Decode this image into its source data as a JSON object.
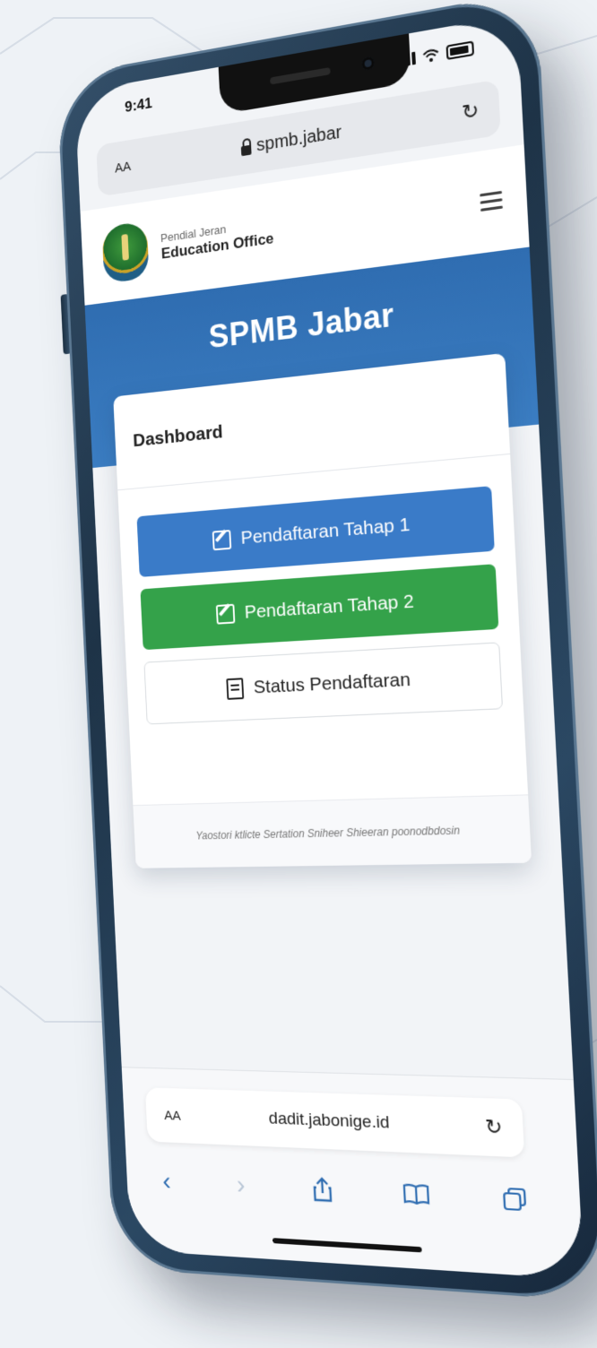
{
  "status_bar": {
    "time": "9:41"
  },
  "browser_top": {
    "text_size": "AA",
    "host": "spmb.jabar"
  },
  "site": {
    "org_line1": "Pendial Jeran",
    "org_line2": "Education Office",
    "hero_title": "SPMB Jabar"
  },
  "card": {
    "title": "Dashboard",
    "buttons": [
      {
        "label": "Pendaftaran Tahap 1"
      },
      {
        "label": "Pendaftaran Tahap 2"
      },
      {
        "label": "Status Pendaftaran"
      }
    ],
    "footer": "Yaostori ktlicte Sertation Sniheer Shieeran poonodbdosin"
  },
  "browser_bottom": {
    "text_size": "AA",
    "host": "dadit.jabonige.id"
  },
  "colors": {
    "hero_blue": "#2f6db1",
    "button_blue": "#3a7bc8",
    "button_green": "#34a24a",
    "phone_frame": "#1e3347"
  }
}
